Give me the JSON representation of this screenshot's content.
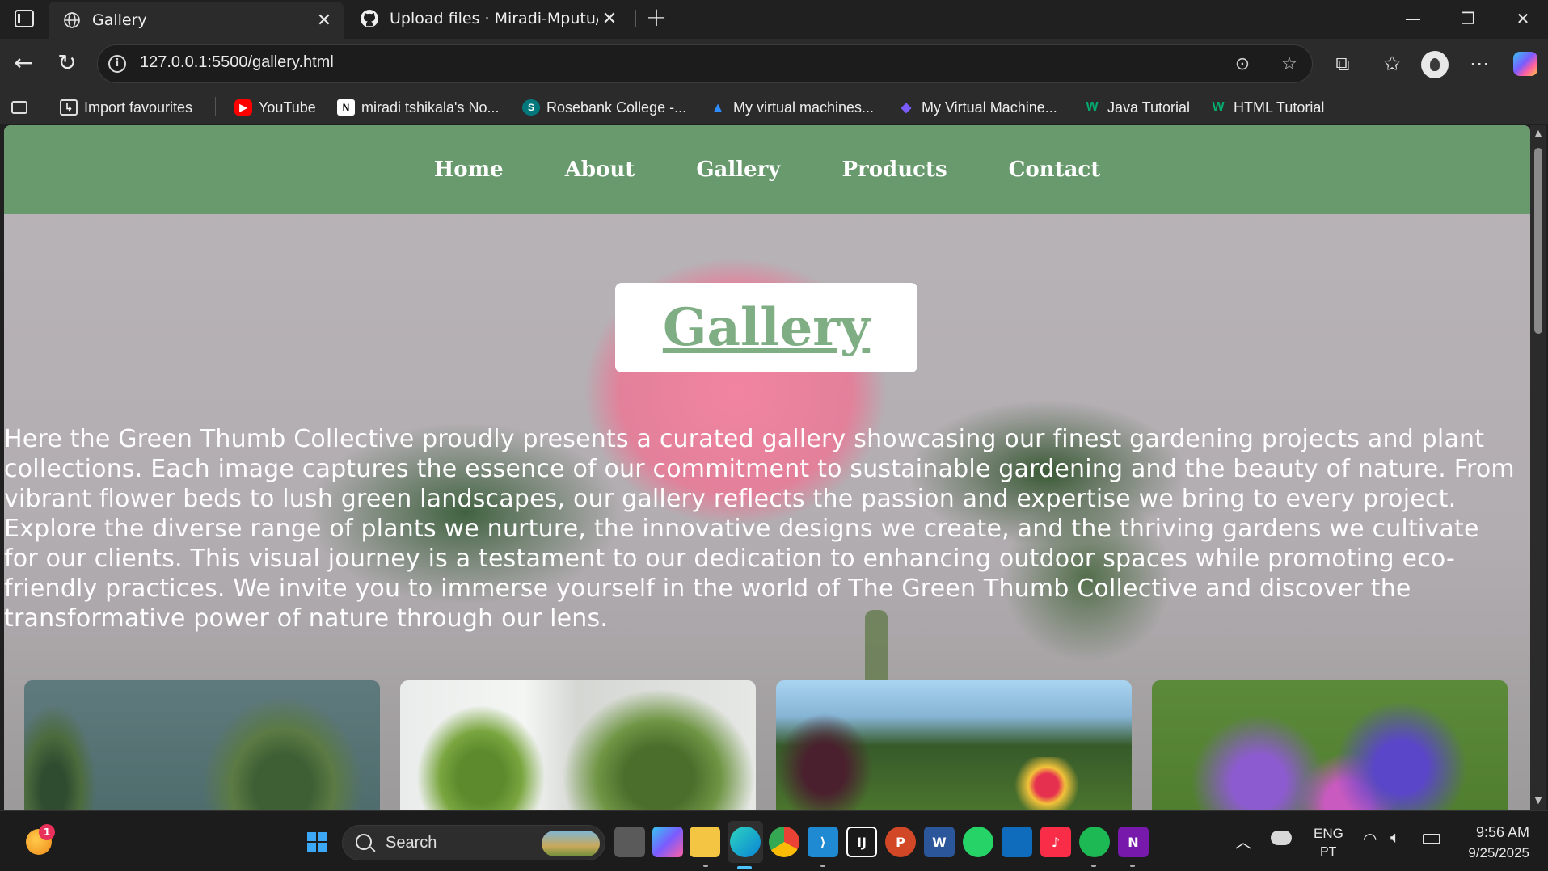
{
  "browser": {
    "tabs": [
      {
        "title": "Gallery",
        "icon": "globe-icon",
        "active": true
      },
      {
        "title": "Upload files · Miradi-Mputu/WEBD",
        "icon": "github-icon",
        "active": false
      }
    ],
    "url": "127.0.0.1:5500/gallery.html",
    "bookmarks": [
      {
        "label": "Import favourites",
        "icon": "import-icon"
      },
      {
        "label": "YouTube",
        "icon": "youtube-icon",
        "color": "#ff0000"
      },
      {
        "label": "miradi tshikala's No...",
        "icon": "notion-icon",
        "color": "#ffffff"
      },
      {
        "label": "Rosebank College -...",
        "icon": "sharepoint-icon",
        "color": "#03787c"
      },
      {
        "label": "My virtual machines...",
        "icon": "azure-icon",
        "color": "#0a66c2"
      },
      {
        "label": "My Virtual Machine...",
        "icon": "azure-labs-icon",
        "color": "#7b5cff"
      },
      {
        "label": "Java Tutorial",
        "icon": "w3schools-icon",
        "color": "#04aa6d"
      },
      {
        "label": "HTML Tutorial",
        "icon": "w3schools-icon",
        "color": "#04aa6d"
      }
    ]
  },
  "site": {
    "nav": [
      "Home",
      "About",
      "Gallery",
      "Products",
      "Contact"
    ],
    "heading": "Gallery",
    "intro": "Here the Green Thumb Collective proudly presents a curated gallery showcasing our finest gardening projects and plant collections. Each image captures the essence of our commitment to sustainable gardening and the beauty of nature. From vibrant flower beds to lush green landscapes, our gallery reflects the passion and expertise we bring to every project. Explore the diverse range of plants we nurture, the innovative designs we create, and the thriving gardens we cultivate for our clients. This visual journey is a testament to our dedication to enhancing outdoor spaces while promoting eco-friendly practices. We invite you to immerse yourself in the world of The Green Thumb Collective and discover the transformative power of nature through our lens.",
    "nav_color": "#629868",
    "heading_color": "#7fae84"
  },
  "taskbar": {
    "weather_badge": "1",
    "search_label": "Search",
    "lang": "ENG",
    "lang_sub": "PT",
    "time": "9:56 AM",
    "date": "9/25/2025"
  }
}
